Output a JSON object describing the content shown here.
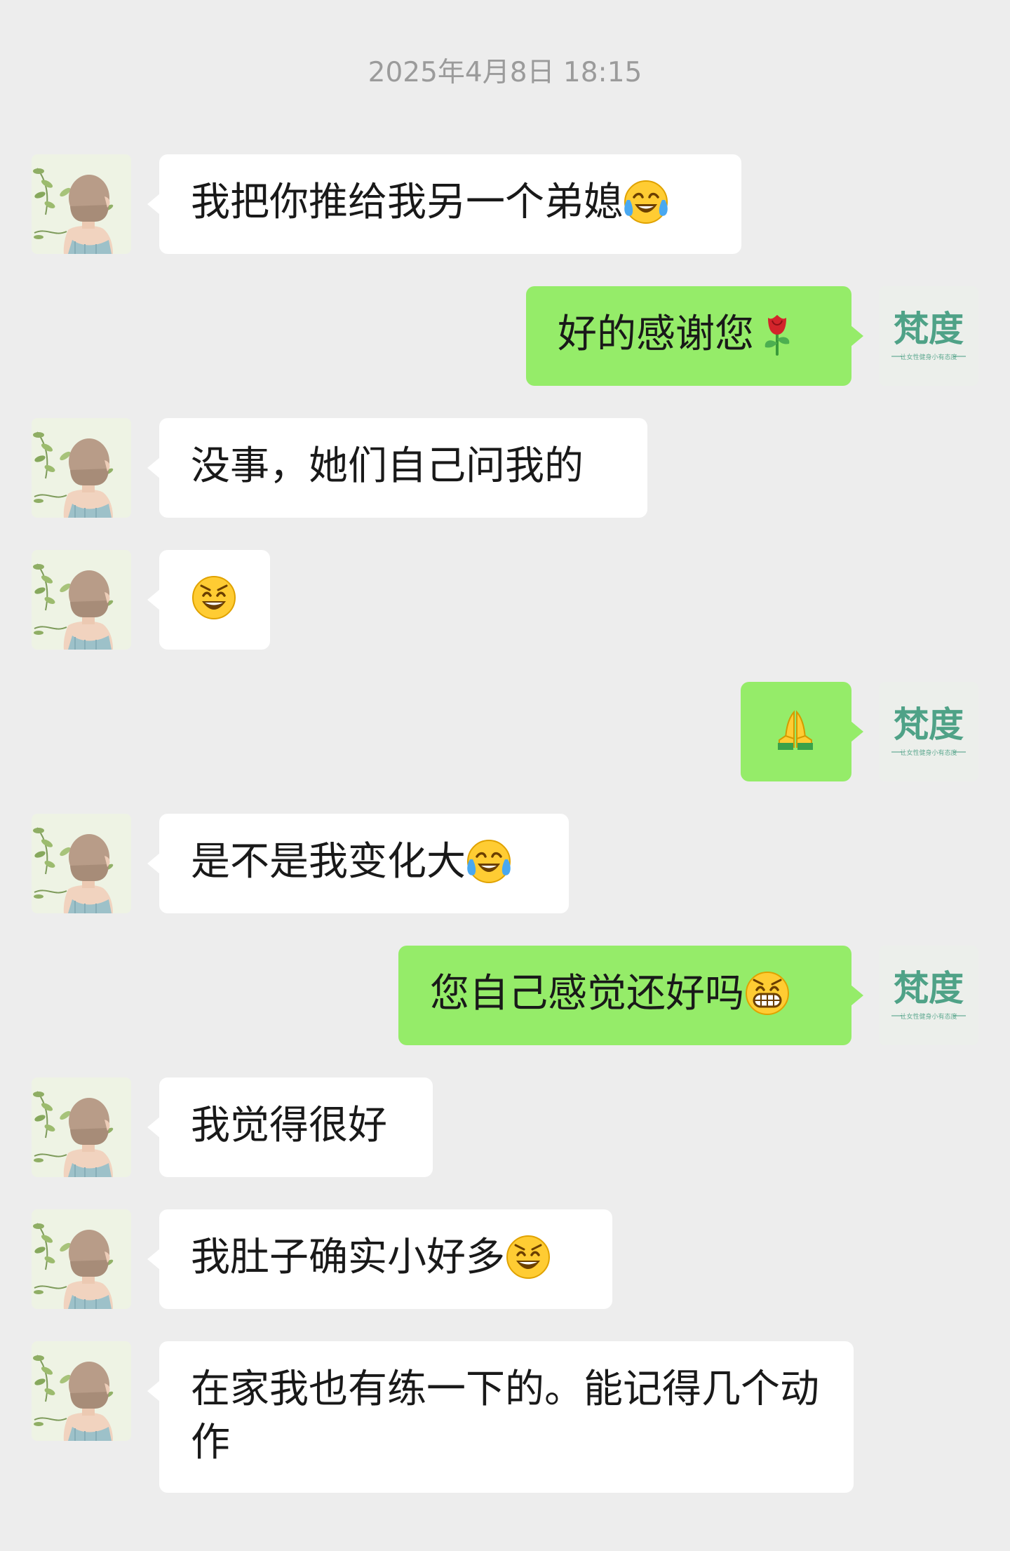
{
  "timestamp": "2025年4月8日 18:15",
  "brand_avatar": {
    "text": "梵度",
    "tagline": "让女性健身小有态度"
  },
  "messages": [
    {
      "side": "left",
      "text": "我把你推给我另一个弟媳",
      "emoji": "laugh-cry-emoji"
    },
    {
      "side": "right",
      "text": "好的感谢您",
      "emoji": "rose-emoji"
    },
    {
      "side": "left",
      "text": "没事，她们自己问我的",
      "emoji": ""
    },
    {
      "side": "left",
      "text": "",
      "emoji": "grin-emoji"
    },
    {
      "side": "right",
      "text": "",
      "emoji": "pray-emoji"
    },
    {
      "side": "left",
      "text": "是不是我变化大",
      "emoji": "laugh-cry-emoji"
    },
    {
      "side": "right",
      "text": "您自己感觉还好吗",
      "emoji": "teeth-grin-emoji"
    },
    {
      "side": "left",
      "text": "我觉得很好",
      "emoji": ""
    },
    {
      "side": "left",
      "text": "我肚子确实小好多",
      "emoji": "grin-emoji"
    },
    {
      "side": "left",
      "text": "在家我也有练一下的。能记得几个动作",
      "emoji": ""
    }
  ],
  "colors": {
    "background": "#ededed",
    "bubble_left": "#ffffff",
    "bubble_right": "#95ec69",
    "timestamp": "#9b9b9b",
    "brand": "#3f9a7d"
  }
}
